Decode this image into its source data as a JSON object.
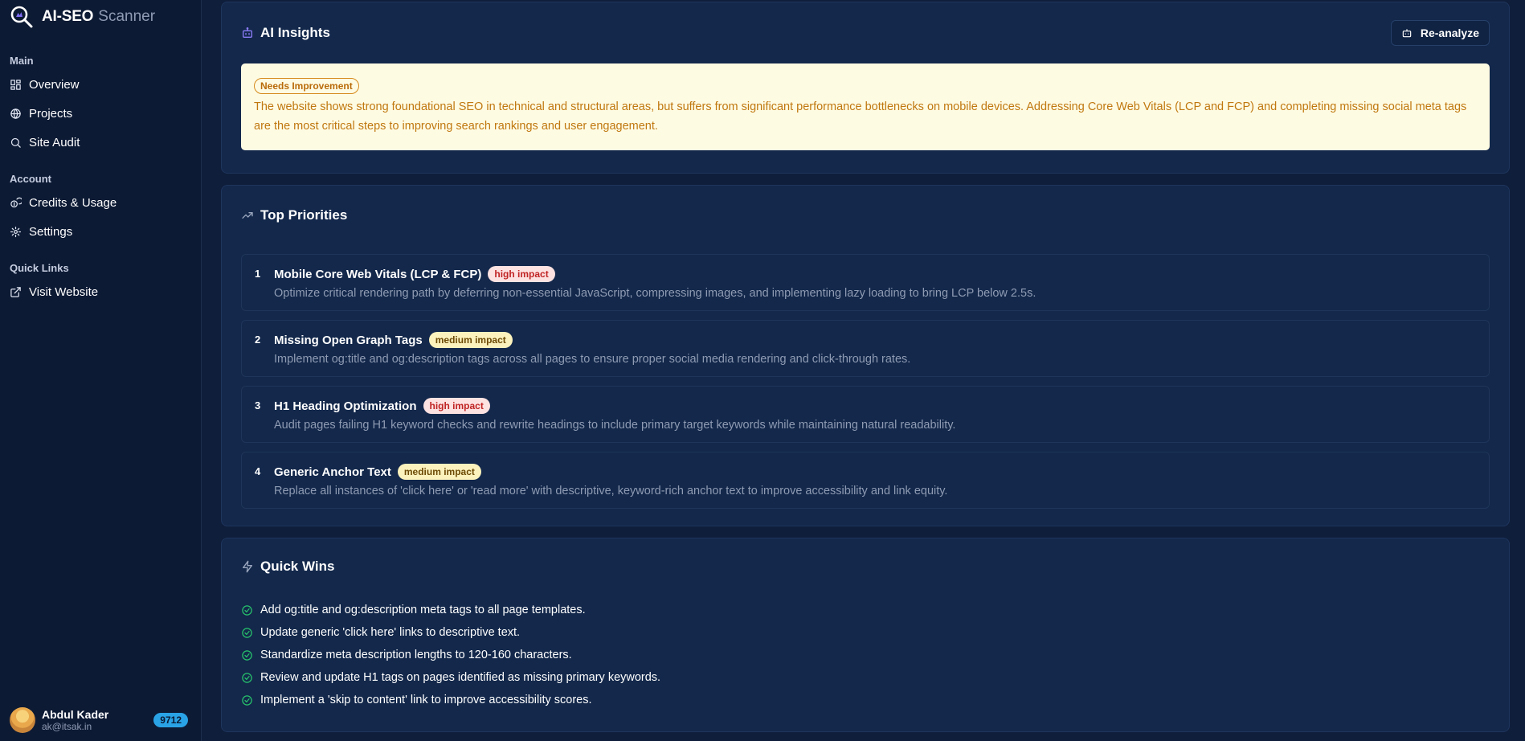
{
  "brand": {
    "name": "AI-SEO",
    "sub": "Scanner"
  },
  "sidebar": {
    "sections": {
      "main": {
        "title": "Main",
        "items": [
          "Overview",
          "Projects",
          "Site Audit"
        ]
      },
      "account": {
        "title": "Account",
        "items": [
          "Credits & Usage",
          "Settings"
        ]
      },
      "links": {
        "title": "Quick Links",
        "items": [
          "Visit Website"
        ]
      }
    },
    "user": {
      "name": "Abdul Kader",
      "email": "ak@itsak.in",
      "credits": "9712"
    }
  },
  "insights": {
    "title": "AI Insights",
    "reanalyze_label": "Re-analyze",
    "status": "Needs Improvement",
    "summary": "The website shows strong foundational SEO in technical and structural areas, but suffers from significant performance bottlenecks on mobile devices. Addressing Core Web Vitals (LCP and FCP) and completing missing social meta tags are the most critical steps to improving search rankings and user engagement."
  },
  "priorities": {
    "title": "Top Priorities",
    "items": [
      {
        "num": "1",
        "title": "Mobile Core Web Vitals (LCP & FCP)",
        "impact": "high impact",
        "desc": "Optimize critical rendering path by deferring non-essential JavaScript, compressing images, and implementing lazy loading to bring LCP below 2.5s."
      },
      {
        "num": "2",
        "title": "Missing Open Graph Tags",
        "impact": "medium impact",
        "desc": "Implement og:title and og:description tags across all pages to ensure proper social media rendering and click-through rates."
      },
      {
        "num": "3",
        "title": "H1 Heading Optimization",
        "impact": "high impact",
        "desc": "Audit pages failing H1 keyword checks and rewrite headings to include primary target keywords while maintaining natural readability."
      },
      {
        "num": "4",
        "title": "Generic Anchor Text",
        "impact": "medium impact",
        "desc": "Replace all instances of 'click here' or 'read more' with descriptive, keyword-rich anchor text to improve accessibility and link equity."
      }
    ]
  },
  "quick_wins": {
    "title": "Quick Wins",
    "items": [
      "Add og:title and og:description meta tags to all page templates.",
      "Update generic 'click here' links to descriptive text.",
      "Standardize meta description lengths to 120-160 characters.",
      "Review and update H1 tags on pages identified as missing primary keywords.",
      "Implement a 'skip to content' link to improve accessibility scores."
    ]
  },
  "colors": {
    "background": "#0f1e3b",
    "card": "#13284b",
    "insight_bg": "#fefbe3",
    "insight_text": "#c0780f",
    "high_impact_bg": "#fde2e2",
    "medium_impact_bg": "#fcf2bd",
    "check_green": "#27c26b",
    "credits_badge": "#2aa3e6"
  }
}
